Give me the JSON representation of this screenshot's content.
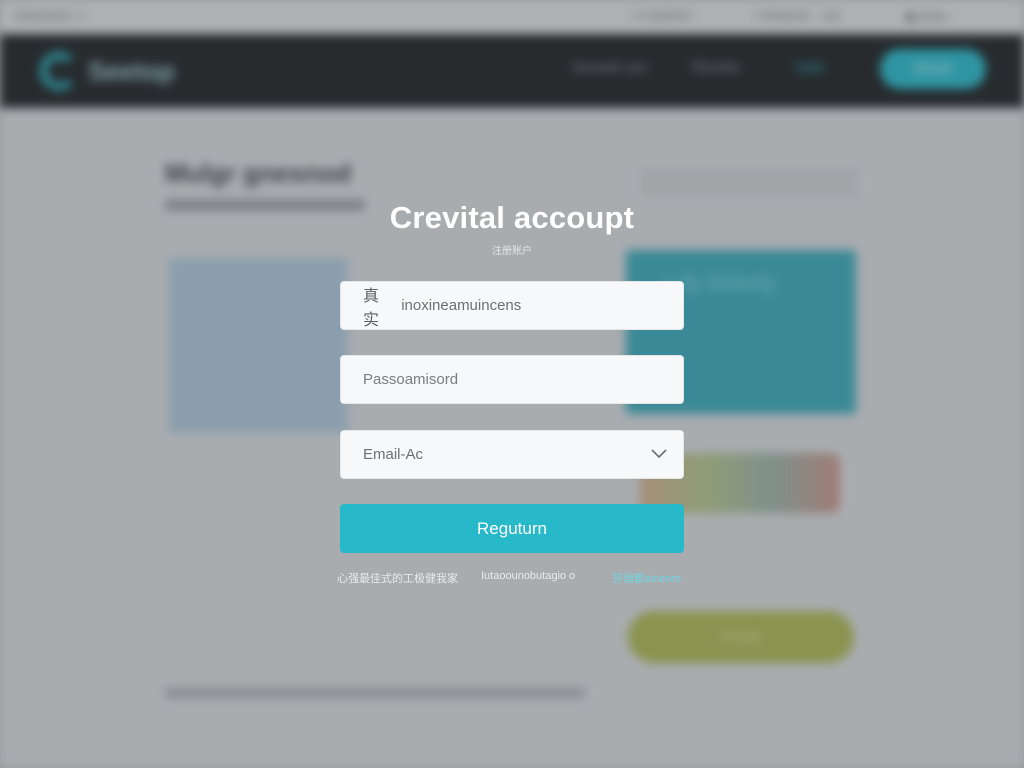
{
  "modal": {
    "title": "Crevital accoupt",
    "subtitle": "注册账户",
    "fields": {
      "username": {
        "prefix": "真实",
        "value": "inoxineamuincens"
      },
      "password": {
        "placeholder": "Passoamisord"
      },
      "email": {
        "value": "Email-Ac"
      }
    },
    "register_label": "Reguturn",
    "footer_links": [
      "心强最佳式的工极健我家",
      "Iutaoounobutagio o",
      "芬销都aineom"
    ]
  },
  "background": {
    "browser_tabs": [
      "Shaneutoss· é",
      "• © teutlsnov ·",
      "• mitvtuenst· · ane",
      "▣ teutov ·"
    ],
    "logo_text": "Seetop",
    "nav": [
      "Soueat usn",
      "Reutrtz",
      "Iosit"
    ],
    "nav_cta": "Eroot",
    "page_title": "Mulgr  gnesnod",
    "card_text": "Lrly Solorty",
    "cta_button": "Ooeal"
  },
  "colors": {
    "accent": "#27b8ca",
    "header_bg": "#1f2326",
    "field_bg": "#f7f8f9"
  }
}
